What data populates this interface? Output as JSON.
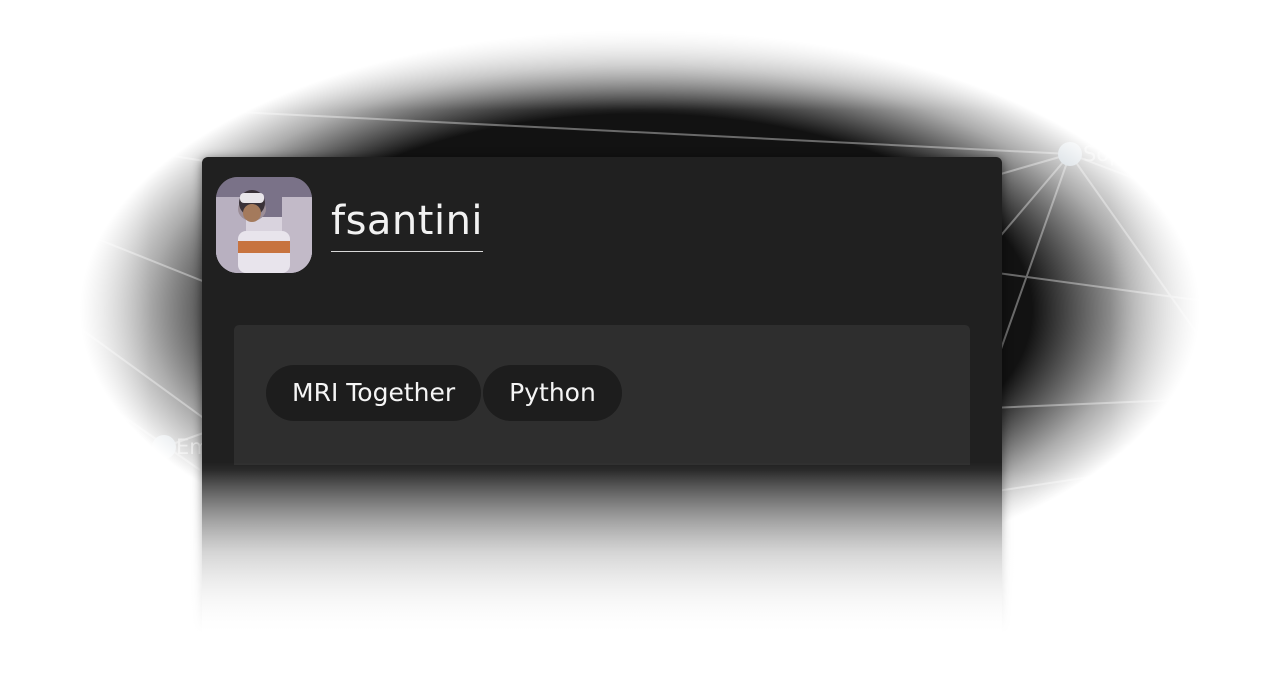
{
  "graph": {
    "nodes": [
      {
        "label": "Sophie Schauman"
      },
      {
        "label": "Emily"
      }
    ],
    "colors": {
      "background": "#121212",
      "edge": "#6a6a6a",
      "node": "#7f95a6",
      "label": "#8d8d8d"
    }
  },
  "profile": {
    "username": "fsantini",
    "avatar_icon": "user-avatar-photo",
    "tags": [
      {
        "label": "MRI Together"
      },
      {
        "label": "Python"
      }
    ],
    "colors": {
      "card": "#202020",
      "panel": "#2e2e2e",
      "chip": "#1d1d1d",
      "text": "#f2f2f2"
    }
  }
}
